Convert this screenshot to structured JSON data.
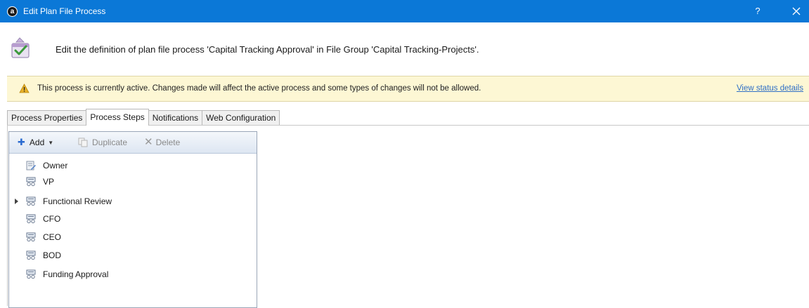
{
  "window": {
    "app_icon_letter": "a",
    "title": "Edit Plan File Process",
    "help_label": "?"
  },
  "header": {
    "description": "Edit the definition of plan file process 'Capital Tracking Approval' in File Group 'Capital Tracking-Projects'."
  },
  "banner": {
    "message": "This process is currently active. Changes made will affect the active process and some types of changes will not be allowed.",
    "link_label": "View status details",
    "bg_color": "#fdf7d4",
    "link_color": "#2f6fc6"
  },
  "tabs": [
    {
      "label": "Process Properties",
      "active": false
    },
    {
      "label": "Process Steps",
      "active": true
    },
    {
      "label": "Notifications",
      "active": false
    },
    {
      "label": "Web Configuration",
      "active": false
    }
  ],
  "toolbar": {
    "add_label": "Add",
    "duplicate_label": "Duplicate",
    "delete_label": "Delete"
  },
  "steps": [
    {
      "label": "Owner",
      "icon": "owner-icon",
      "expandable": false
    },
    {
      "label": "VP",
      "icon": "step-icon",
      "expandable": false
    },
    {
      "label": "Functional Review",
      "icon": "step-icon",
      "expandable": true
    },
    {
      "label": "CFO",
      "icon": "step-icon",
      "expandable": false
    },
    {
      "label": "CEO",
      "icon": "step-icon",
      "expandable": false
    },
    {
      "label": "BOD",
      "icon": "step-icon",
      "expandable": false
    },
    {
      "label": "Funding Approval",
      "icon": "step-icon",
      "expandable": false
    }
  ],
  "colors": {
    "title_bar": "#0b78d7",
    "accent": "#2a6bd0"
  }
}
